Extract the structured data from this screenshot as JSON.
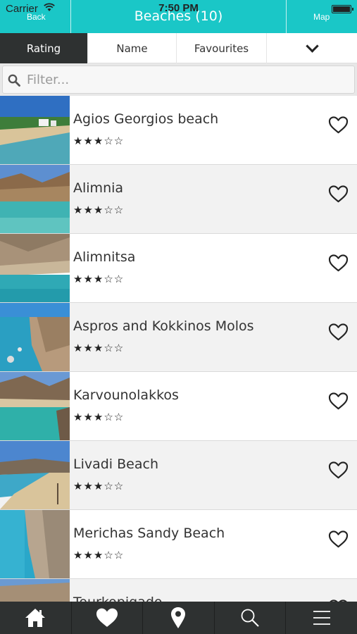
{
  "status_bar": {
    "carrier": "Carrier",
    "time": "7:50 PM"
  },
  "header": {
    "back_label": "Back",
    "title": "Beaches (10)",
    "map_label": "Map",
    "color": "#1ac7c7"
  },
  "sort_tabs": [
    {
      "label": "Rating",
      "active": true
    },
    {
      "label": "Name",
      "active": false
    },
    {
      "label": "Favourites",
      "active": false
    }
  ],
  "filter": {
    "placeholder": "Filter...",
    "value": ""
  },
  "beaches": [
    {
      "name": "Agios Georgios beach",
      "stars": "★★★☆☆",
      "rating": 3,
      "favourite": false
    },
    {
      "name": "Alimnia",
      "stars": "★★★☆☆",
      "rating": 3,
      "favourite": false
    },
    {
      "name": "Alimnitsa",
      "stars": "★★★☆☆",
      "rating": 3,
      "favourite": false
    },
    {
      "name": "Aspros and Kokkinos Molos",
      "stars": "★★★☆☆",
      "rating": 3,
      "favourite": false
    },
    {
      "name": "Karvounolakkos",
      "stars": "★★★☆☆",
      "rating": 3,
      "favourite": false
    },
    {
      "name": "Livadi Beach",
      "stars": "★★★☆☆",
      "rating": 3,
      "favourite": false
    },
    {
      "name": "Merichas Sandy Beach",
      "stars": "★★★☆☆",
      "rating": 3,
      "favourite": false
    },
    {
      "name": "Tourkopigado",
      "stars": "",
      "rating": null,
      "favourite": false
    }
  ],
  "tabbar": [
    {
      "icon": "home-icon"
    },
    {
      "icon": "heart-icon"
    },
    {
      "icon": "location-pin-icon"
    },
    {
      "icon": "search-icon"
    },
    {
      "icon": "menu-icon"
    }
  ],
  "colors": {
    "active_tab": "#2e3131",
    "tabbar": "#2e3131"
  }
}
